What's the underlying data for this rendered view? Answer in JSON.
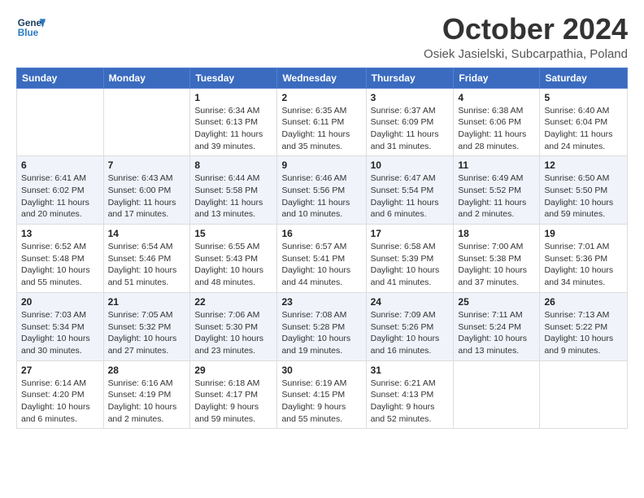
{
  "logo": {
    "line1": "General",
    "line2": "Blue"
  },
  "title": "October 2024",
  "subtitle": "Osiek Jasielski, Subcarpathia, Poland",
  "days_of_week": [
    "Sunday",
    "Monday",
    "Tuesday",
    "Wednesday",
    "Thursday",
    "Friday",
    "Saturday"
  ],
  "weeks": [
    [
      {
        "day": "",
        "info": ""
      },
      {
        "day": "",
        "info": ""
      },
      {
        "day": "1",
        "info": "Sunrise: 6:34 AM\nSunset: 6:13 PM\nDaylight: 11 hours and 39 minutes."
      },
      {
        "day": "2",
        "info": "Sunrise: 6:35 AM\nSunset: 6:11 PM\nDaylight: 11 hours and 35 minutes."
      },
      {
        "day": "3",
        "info": "Sunrise: 6:37 AM\nSunset: 6:09 PM\nDaylight: 11 hours and 31 minutes."
      },
      {
        "day": "4",
        "info": "Sunrise: 6:38 AM\nSunset: 6:06 PM\nDaylight: 11 hours and 28 minutes."
      },
      {
        "day": "5",
        "info": "Sunrise: 6:40 AM\nSunset: 6:04 PM\nDaylight: 11 hours and 24 minutes."
      }
    ],
    [
      {
        "day": "6",
        "info": "Sunrise: 6:41 AM\nSunset: 6:02 PM\nDaylight: 11 hours and 20 minutes."
      },
      {
        "day": "7",
        "info": "Sunrise: 6:43 AM\nSunset: 6:00 PM\nDaylight: 11 hours and 17 minutes."
      },
      {
        "day": "8",
        "info": "Sunrise: 6:44 AM\nSunset: 5:58 PM\nDaylight: 11 hours and 13 minutes."
      },
      {
        "day": "9",
        "info": "Sunrise: 6:46 AM\nSunset: 5:56 PM\nDaylight: 11 hours and 10 minutes."
      },
      {
        "day": "10",
        "info": "Sunrise: 6:47 AM\nSunset: 5:54 PM\nDaylight: 11 hours and 6 minutes."
      },
      {
        "day": "11",
        "info": "Sunrise: 6:49 AM\nSunset: 5:52 PM\nDaylight: 11 hours and 2 minutes."
      },
      {
        "day": "12",
        "info": "Sunrise: 6:50 AM\nSunset: 5:50 PM\nDaylight: 10 hours and 59 minutes."
      }
    ],
    [
      {
        "day": "13",
        "info": "Sunrise: 6:52 AM\nSunset: 5:48 PM\nDaylight: 10 hours and 55 minutes."
      },
      {
        "day": "14",
        "info": "Sunrise: 6:54 AM\nSunset: 5:46 PM\nDaylight: 10 hours and 51 minutes."
      },
      {
        "day": "15",
        "info": "Sunrise: 6:55 AM\nSunset: 5:43 PM\nDaylight: 10 hours and 48 minutes."
      },
      {
        "day": "16",
        "info": "Sunrise: 6:57 AM\nSunset: 5:41 PM\nDaylight: 10 hours and 44 minutes."
      },
      {
        "day": "17",
        "info": "Sunrise: 6:58 AM\nSunset: 5:39 PM\nDaylight: 10 hours and 41 minutes."
      },
      {
        "day": "18",
        "info": "Sunrise: 7:00 AM\nSunset: 5:38 PM\nDaylight: 10 hours and 37 minutes."
      },
      {
        "day": "19",
        "info": "Sunrise: 7:01 AM\nSunset: 5:36 PM\nDaylight: 10 hours and 34 minutes."
      }
    ],
    [
      {
        "day": "20",
        "info": "Sunrise: 7:03 AM\nSunset: 5:34 PM\nDaylight: 10 hours and 30 minutes."
      },
      {
        "day": "21",
        "info": "Sunrise: 7:05 AM\nSunset: 5:32 PM\nDaylight: 10 hours and 27 minutes."
      },
      {
        "day": "22",
        "info": "Sunrise: 7:06 AM\nSunset: 5:30 PM\nDaylight: 10 hours and 23 minutes."
      },
      {
        "day": "23",
        "info": "Sunrise: 7:08 AM\nSunset: 5:28 PM\nDaylight: 10 hours and 19 minutes."
      },
      {
        "day": "24",
        "info": "Sunrise: 7:09 AM\nSunset: 5:26 PM\nDaylight: 10 hours and 16 minutes."
      },
      {
        "day": "25",
        "info": "Sunrise: 7:11 AM\nSunset: 5:24 PM\nDaylight: 10 hours and 13 minutes."
      },
      {
        "day": "26",
        "info": "Sunrise: 7:13 AM\nSunset: 5:22 PM\nDaylight: 10 hours and 9 minutes."
      }
    ],
    [
      {
        "day": "27",
        "info": "Sunrise: 6:14 AM\nSunset: 4:20 PM\nDaylight: 10 hours and 6 minutes."
      },
      {
        "day": "28",
        "info": "Sunrise: 6:16 AM\nSunset: 4:19 PM\nDaylight: 10 hours and 2 minutes."
      },
      {
        "day": "29",
        "info": "Sunrise: 6:18 AM\nSunset: 4:17 PM\nDaylight: 9 hours and 59 minutes."
      },
      {
        "day": "30",
        "info": "Sunrise: 6:19 AM\nSunset: 4:15 PM\nDaylight: 9 hours and 55 minutes."
      },
      {
        "day": "31",
        "info": "Sunrise: 6:21 AM\nSunset: 4:13 PM\nDaylight: 9 hours and 52 minutes."
      },
      {
        "day": "",
        "info": ""
      },
      {
        "day": "",
        "info": ""
      }
    ]
  ]
}
